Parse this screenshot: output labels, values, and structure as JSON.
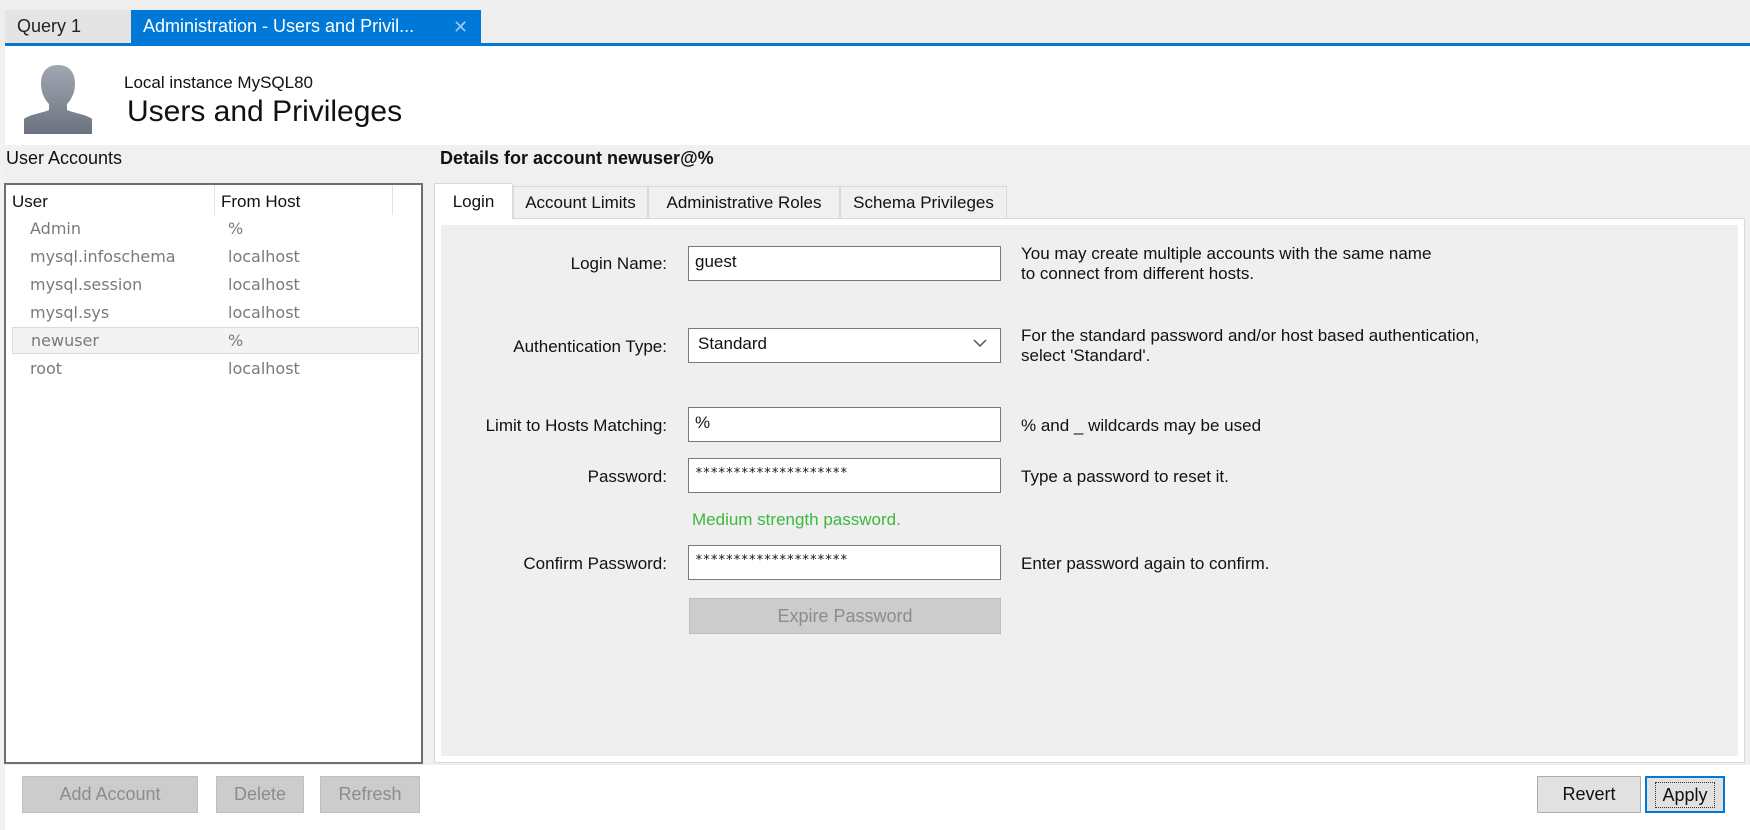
{
  "doc_tabs": [
    {
      "label": "Query 1",
      "active": false
    },
    {
      "label": "Administration - Users and Privil...",
      "active": true,
      "close_icon": "close-icon"
    }
  ],
  "header": {
    "avatar_icon": "user-silhouette-icon",
    "instance": "Local instance MySQL80",
    "title": "Users and Privileges"
  },
  "user_accounts": {
    "label": "User Accounts",
    "columns": [
      "User",
      "From Host"
    ],
    "rows": [
      {
        "user": "Admin",
        "host": "%"
      },
      {
        "user": "mysql.infoschema",
        "host": "localhost"
      },
      {
        "user": "mysql.session",
        "host": "localhost"
      },
      {
        "user": "mysql.sys",
        "host": "localhost"
      },
      {
        "user": "newuser",
        "host": "%",
        "selected": true
      },
      {
        "user": "root",
        "host": "localhost"
      }
    ],
    "buttons": {
      "add": "Add Account",
      "delete": "Delete",
      "refresh": "Refresh"
    }
  },
  "details": {
    "title": "Details for account newuser@%",
    "tabs": [
      "Login",
      "Account Limits",
      "Administrative Roles",
      "Schema Privileges"
    ],
    "active_tab": "Login",
    "form": {
      "login_name": {
        "label": "Login Name:",
        "value": "guest",
        "help": [
          "You may create multiple accounts with the same name",
          "to connect from different hosts."
        ]
      },
      "auth_type": {
        "label": "Authentication Type:",
        "value": "Standard",
        "help": [
          "For the standard password and/or host based authentication,",
          "select 'Standard'."
        ]
      },
      "hosts": {
        "label": "Limit to Hosts Matching:",
        "value": "%",
        "help": "% and _ wildcards may be used"
      },
      "password": {
        "label": "Password:",
        "value": "********************",
        "help": "Type a password to reset it."
      },
      "strength": "Medium strength password.",
      "confirm": {
        "label": "Confirm Password:",
        "value": "********************",
        "help": "Enter password again to confirm."
      },
      "expire_button": "Expire Password"
    },
    "buttons": {
      "revert": "Revert",
      "apply": "Apply"
    }
  },
  "colors": {
    "accent": "#0078d7",
    "strength_medium": "#3db83d",
    "disabled_button": "#cccccc"
  }
}
